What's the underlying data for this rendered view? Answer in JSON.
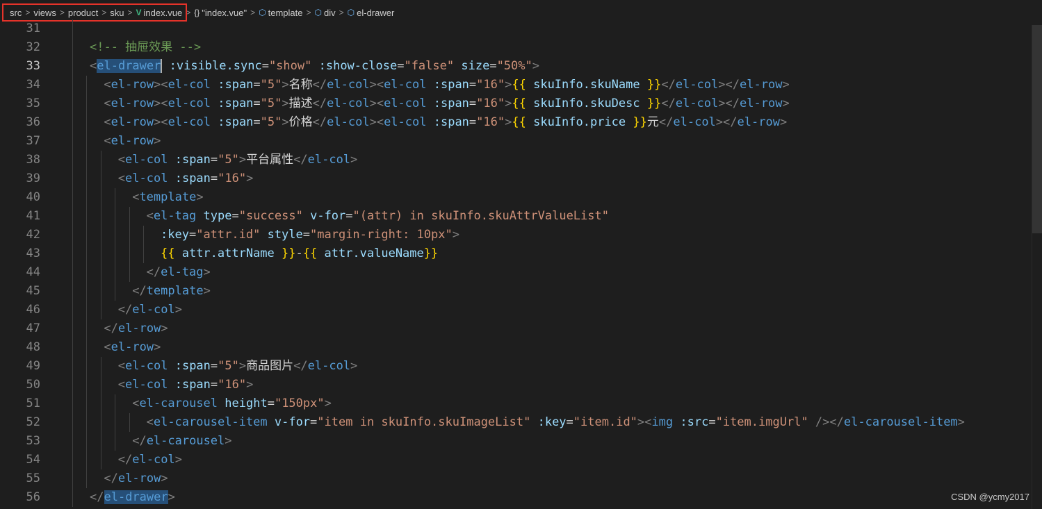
{
  "breadcrumb": {
    "src": "src",
    "views": "views",
    "product": "product",
    "sku": "sku",
    "file": "index.vue",
    "object": "\"index.vue\"",
    "template": "template",
    "div": "div",
    "drawer": "el-drawer"
  },
  "icons": {
    "vue": "vue-logo-icon",
    "braces": "braces-icon",
    "cube": "cube-icon",
    "chevron": "chevron-right-icon"
  },
  "colors": {
    "background": "#1e1e1e",
    "tag": "#569cd6",
    "attribute": "#9cdcfe",
    "string": "#ce9178",
    "comment": "#6a9955",
    "mustache": "#ffd700",
    "highlight_border": "#e5332a"
  },
  "editor": {
    "active_line": 33,
    "line_numbers": [
      "31",
      "32",
      "33",
      "34",
      "35",
      "36",
      "37",
      "38",
      "39",
      "40",
      "41",
      "42",
      "43",
      "44",
      "45",
      "46",
      "47",
      "48",
      "49",
      "50",
      "51",
      "52",
      "53",
      "54",
      "55",
      "56"
    ],
    "lines": [
      "",
      "<!-- 抽屉效果 -->",
      "<el-drawer :visible.sync=\"show\" :show-close=\"false\" size=\"50%\">",
      "<el-row><el-col :span=\"5\">名称</el-col><el-col :span=\"16\">{{ skuInfo.skuName }}</el-col></el-row>",
      "<el-row><el-col :span=\"5\">描述</el-col><el-col :span=\"16\">{{ skuInfo.skuDesc }}</el-col></el-row>",
      "<el-row><el-col :span=\"5\">价格</el-col><el-col :span=\"16\">{{ skuInfo.price }}元</el-col></el-row>",
      "<el-row>",
      "<el-col :span=\"5\">平台属性</el-col>",
      "<el-col :span=\"16\">",
      "<template>",
      "<el-tag type=\"success\" v-for=\"(attr) in skuInfo.skuAttrValueList\"",
      ":key=\"attr.id\" style=\"margin-right: 10px\">",
      "{{ attr.attrName }}-{{ attr.valueName}}",
      "</el-tag>",
      "</template>",
      "</el-col>",
      "</el-row>",
      "<el-row>",
      "<el-col :span=\"5\">商品图片</el-col>",
      "<el-col :span=\"16\">",
      "<el-carousel height=\"150px\">",
      "<el-carousel-item v-for=\"item in skuInfo.skuImageList\" :key=\"item.id\"><img :src=\"item.imgUrl\" /></el-carousel-item>",
      "</el-carousel>",
      "</el-col>",
      "</el-row>",
      "</el-drawer>"
    ]
  },
  "watermark": "CSDN @ycmy2017"
}
